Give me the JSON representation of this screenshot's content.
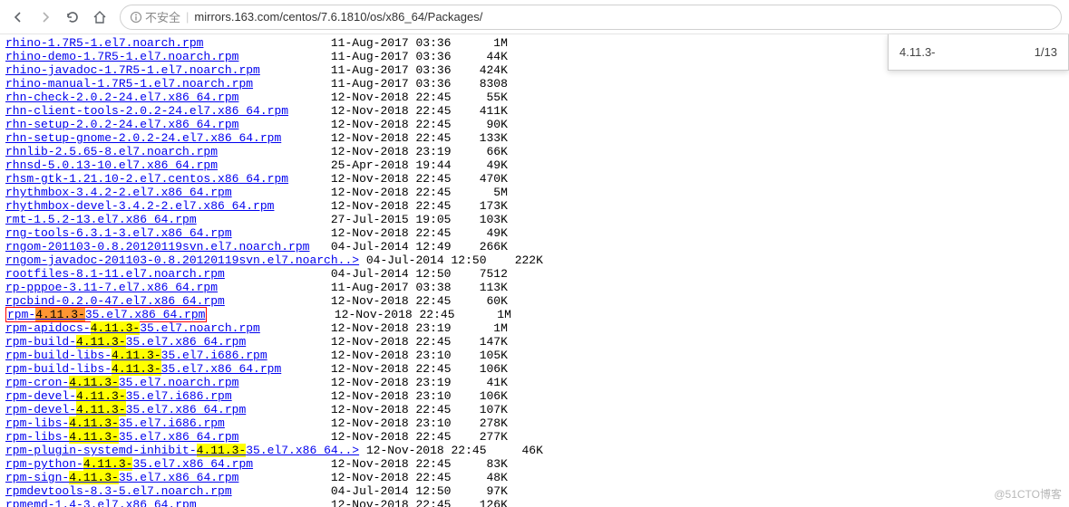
{
  "toolbar": {
    "insecure_label": "不安全",
    "url": "mirrors.163.com/centos/7.6.1810/os/x86_64/Packages/"
  },
  "find": {
    "term": "4.11.3-",
    "count": "1/13"
  },
  "watermark": "@51CTO博客",
  "col1": 46,
  "col2": 65,
  "files": [
    {
      "name": "rhino-1.7R5-1.el7.noarch.rpm",
      "date": "11-Aug-2017 03:36",
      "size": "1M"
    },
    {
      "name": "rhino-demo-1.7R5-1.el7.noarch.rpm",
      "date": "11-Aug-2017 03:36",
      "size": "44K"
    },
    {
      "name": "rhino-javadoc-1.7R5-1.el7.noarch.rpm",
      "date": "11-Aug-2017 03:36",
      "size": "424K"
    },
    {
      "name": "rhino-manual-1.7R5-1.el7.noarch.rpm",
      "date": "11-Aug-2017 03:36",
      "size": "8308"
    },
    {
      "name": "rhn-check-2.0.2-24.el7.x86_64.rpm",
      "date": "12-Nov-2018 22:45",
      "size": "55K"
    },
    {
      "name": "rhn-client-tools-2.0.2-24.el7.x86_64.rpm",
      "date": "12-Nov-2018 22:45",
      "size": "411K"
    },
    {
      "name": "rhn-setup-2.0.2-24.el7.x86_64.rpm",
      "date": "12-Nov-2018 22:45",
      "size": "90K"
    },
    {
      "name": "rhn-setup-gnome-2.0.2-24.el7.x86_64.rpm",
      "date": "12-Nov-2018 22:45",
      "size": "133K"
    },
    {
      "name": "rhnlib-2.5.65-8.el7.noarch.rpm",
      "date": "12-Nov-2018 23:19",
      "size": "66K"
    },
    {
      "name": "rhnsd-5.0.13-10.el7.x86_64.rpm",
      "date": "25-Apr-2018 19:44",
      "size": "49K"
    },
    {
      "name": "rhsm-gtk-1.21.10-2.el7.centos.x86_64.rpm",
      "date": "12-Nov-2018 22:45",
      "size": "470K"
    },
    {
      "name": "rhythmbox-3.4.2-2.el7.x86_64.rpm",
      "date": "12-Nov-2018 22:45",
      "size": "5M"
    },
    {
      "name": "rhythmbox-devel-3.4.2-2.el7.x86_64.rpm",
      "date": "12-Nov-2018 22:45",
      "size": "173K"
    },
    {
      "name": "rmt-1.5.2-13.el7.x86_64.rpm",
      "date": "27-Jul-2015 19:05",
      "size": "103K"
    },
    {
      "name": "rng-tools-6.3.1-3.el7.x86_64.rpm",
      "date": "12-Nov-2018 22:45",
      "size": "49K"
    },
    {
      "name": "rngom-201103-0.8.20120119svn.el7.noarch.rpm",
      "date": "04-Jul-2014 12:49",
      "size": "266K"
    },
    {
      "name": "rngom-javadoc-201103-0.8.20120119svn.el7.noarch..>",
      "date": "04-Jul-2014 12:50",
      "size": "222K"
    },
    {
      "name": "rootfiles-8.1-11.el7.noarch.rpm",
      "date": "04-Jul-2014 12:50",
      "size": "7512"
    },
    {
      "name": "rp-pppoe-3.11-7.el7.x86_64.rpm",
      "date": "11-Aug-2017 03:38",
      "size": "113K"
    },
    {
      "name": "rpcbind-0.2.0-47.el7.x86_64.rpm",
      "date": "12-Nov-2018 22:45",
      "size": "60K"
    },
    {
      "name": "rpm-4.11.3-35.el7.x86_64.rpm",
      "date": "12-Nov-2018 22:45",
      "size": "1M",
      "boxed": true,
      "hl": [
        4,
        11
      ],
      "active": true
    },
    {
      "name": "rpm-apidocs-4.11.3-35.el7.noarch.rpm",
      "date": "12-Nov-2018 23:19",
      "size": "1M",
      "hl": [
        12,
        19
      ]
    },
    {
      "name": "rpm-build-4.11.3-35.el7.x86_64.rpm",
      "date": "12-Nov-2018 22:45",
      "size": "147K",
      "hl": [
        10,
        17
      ]
    },
    {
      "name": "rpm-build-libs-4.11.3-35.el7.i686.rpm",
      "date": "12-Nov-2018 23:10",
      "size": "105K",
      "hl": [
        15,
        22
      ]
    },
    {
      "name": "rpm-build-libs-4.11.3-35.el7.x86_64.rpm",
      "date": "12-Nov-2018 22:45",
      "size": "106K",
      "hl": [
        15,
        22
      ]
    },
    {
      "name": "rpm-cron-4.11.3-35.el7.noarch.rpm",
      "date": "12-Nov-2018 23:19",
      "size": "41K",
      "hl": [
        9,
        16
      ]
    },
    {
      "name": "rpm-devel-4.11.3-35.el7.i686.rpm",
      "date": "12-Nov-2018 23:10",
      "size": "106K",
      "hl": [
        10,
        17
      ]
    },
    {
      "name": "rpm-devel-4.11.3-35.el7.x86_64.rpm",
      "date": "12-Nov-2018 22:45",
      "size": "107K",
      "hl": [
        10,
        17
      ]
    },
    {
      "name": "rpm-libs-4.11.3-35.el7.i686.rpm",
      "date": "12-Nov-2018 23:10",
      "size": "278K",
      "hl": [
        9,
        16
      ]
    },
    {
      "name": "rpm-libs-4.11.3-35.el7.x86_64.rpm",
      "date": "12-Nov-2018 22:45",
      "size": "277K",
      "hl": [
        9,
        16
      ]
    },
    {
      "name": "rpm-plugin-systemd-inhibit-4.11.3-35.el7.x86_64..>",
      "date": "12-Nov-2018 22:45",
      "size": "46K",
      "hl": [
        27,
        34
      ]
    },
    {
      "name": "rpm-python-4.11.3-35.el7.x86_64.rpm",
      "date": "12-Nov-2018 22:45",
      "size": "83K",
      "hl": [
        11,
        18
      ]
    },
    {
      "name": "rpm-sign-4.11.3-35.el7.x86_64.rpm",
      "date": "12-Nov-2018 22:45",
      "size": "48K",
      "hl": [
        9,
        16
      ]
    },
    {
      "name": "rpmdevtools-8.3-5.el7.noarch.rpm",
      "date": "04-Jul-2014 12:50",
      "size": "97K"
    },
    {
      "name": "rpmemd-1.4-3.el7.x86_64.rpm",
      "date": "12-Nov-2018 22:45",
      "size": "126K"
    }
  ]
}
